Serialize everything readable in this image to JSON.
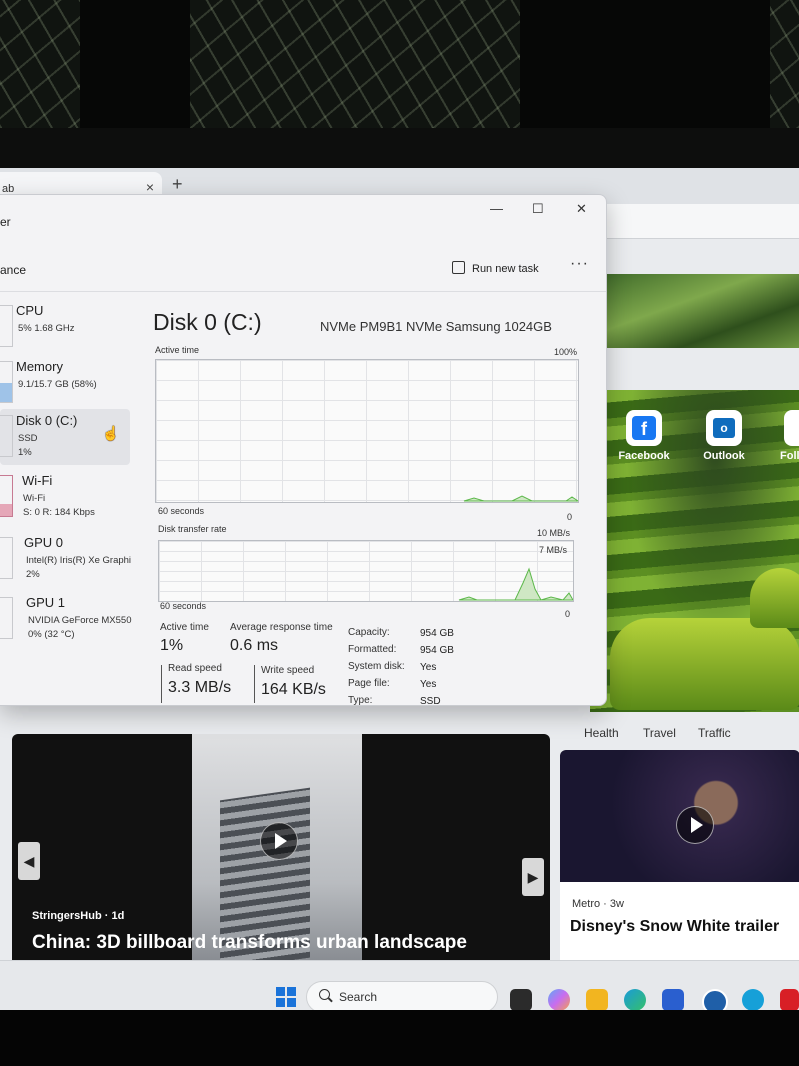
{
  "browser": {
    "tab_label": "ab",
    "tab_close": "×",
    "new_tab": "+"
  },
  "quick_links": [
    {
      "label": "Facebook",
      "icon": "facebook-icon"
    },
    {
      "label": "Outlook",
      "icon": "outlook-icon"
    },
    {
      "label": "Foll",
      "icon": "follow-icon"
    }
  ],
  "news_nav": [
    "Health",
    "Travel",
    "Traffic"
  ],
  "news": {
    "main": {
      "source": "StringersHub · 1d",
      "headline": "China: 3D billboard transforms urban landscape"
    },
    "side": {
      "source": "Metro · 3w",
      "headline": "Disney's Snow White trailer"
    }
  },
  "task_manager": {
    "title": "er",
    "page": "ance",
    "run_new_task": "Run new task",
    "more": "···",
    "window_buttons": {
      "minimize": "—",
      "maximize": "☐",
      "close": "✕"
    },
    "sidebar": [
      {
        "name": "CPU",
        "sub1": "5% 1.68 GHz",
        "sub2": "",
        "sub3": "",
        "active": false
      },
      {
        "name": "Memory",
        "sub1": "9.1/15.7 GB (58%)",
        "sub2": "",
        "sub3": "",
        "active": false
      },
      {
        "name": "Disk 0 (C:)",
        "sub1": "SSD",
        "sub2": "1%",
        "sub3": "",
        "active": true
      },
      {
        "name": "Wi-Fi",
        "sub1": "Wi-Fi",
        "sub2": "S: 0 R: 184 Kbps",
        "sub3": "",
        "active": false
      },
      {
        "name": "GPU 0",
        "sub1": "Intel(R) Iris(R) Xe Graphi",
        "sub2": "2%",
        "sub3": "",
        "active": false
      },
      {
        "name": "GPU 1",
        "sub1": "NVIDIA GeForce MX550",
        "sub2": "0% (32 °C)",
        "sub3": "",
        "active": false
      }
    ],
    "disk": {
      "title": "Disk 0 (C:)",
      "model": "NVMe PM9B1 NVMe Samsung 1024GB",
      "active_time_label": "Active time",
      "active_time_max": "100%",
      "seconds_label_1": "60 seconds",
      "zero_1": "0",
      "transfer_label": "Disk transfer rate",
      "transfer_max": "10 MB/s",
      "transfer_mid": "7 MB/s",
      "seconds_label_2": "60 seconds",
      "zero_2": "0",
      "stats": {
        "active_time_label": "Active time",
        "active_time_value": "1%",
        "avg_response_label": "Average response time",
        "avg_response_value": "0.6 ms",
        "read_label": "Read speed",
        "read_value": "3.3 MB/s",
        "write_label": "Write speed",
        "write_value": "164 KB/s"
      },
      "properties": [
        {
          "key": "Capacity:",
          "value": "954 GB"
        },
        {
          "key": "Formatted:",
          "value": "954 GB"
        },
        {
          "key": "System disk:",
          "value": "Yes"
        },
        {
          "key": "Page file:",
          "value": "Yes"
        },
        {
          "key": "Type:",
          "value": "SSD"
        }
      ]
    }
  },
  "taskbar": {
    "search_placeholder": "Search",
    "apps": [
      {
        "icon": "task-view-icon",
        "color": "#2b2b2b"
      },
      {
        "icon": "copilot-icon",
        "color": "#c86cf0"
      },
      {
        "icon": "file-explorer-icon",
        "color": "#f2b520"
      },
      {
        "icon": "edge-icon",
        "color": "#1a9bd8"
      },
      {
        "icon": "store-icon",
        "color": "#2a5fcf"
      },
      {
        "icon": "dell-icon",
        "color": "#1f5fa8"
      },
      {
        "icon": "alexa-icon",
        "color": "#16a0d8"
      },
      {
        "icon": "mcafee-icon",
        "color": "#d81f26"
      }
    ]
  },
  "colors": {
    "graph_line": "#5cb84a",
    "accent": "#1a73d9"
  }
}
